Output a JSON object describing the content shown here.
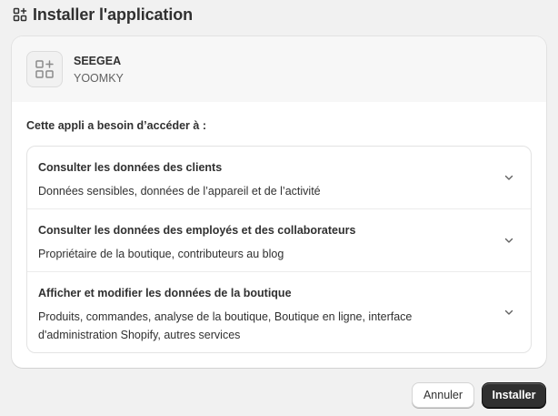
{
  "page": {
    "title": "Installer l'application",
    "title_icon": "apps-add-icon"
  },
  "app": {
    "name": "SEEGEA",
    "developer": "YOOMKY",
    "logo_icon": "apps-add-icon"
  },
  "access": {
    "title": "Cette appli a besoin d’accéder à :",
    "permissions": [
      {
        "title": "Consulter les données des clients",
        "description": "Données sensibles, données de l’appareil et de l’activité",
        "icon": "chevron-down-icon"
      },
      {
        "title": "Consulter les données des employés et des collaborateurs",
        "description": "Propriétaire de la boutique, contributeurs au blog",
        "icon": "chevron-down-icon"
      },
      {
        "title": "Afficher et modifier les données de la boutique",
        "description": "Produits, commandes, analyse de la boutique, Boutique en ligne, interface d'administration Shopify, autres services",
        "icon": "chevron-down-icon"
      }
    ]
  },
  "actions": {
    "cancel_label": "Annuler",
    "install_label": "Installer"
  },
  "colors": {
    "background": "#f1f1f1",
    "card": "#ffffff",
    "primary_button": "#303030",
    "text": "#303030",
    "muted_text": "#616161"
  }
}
